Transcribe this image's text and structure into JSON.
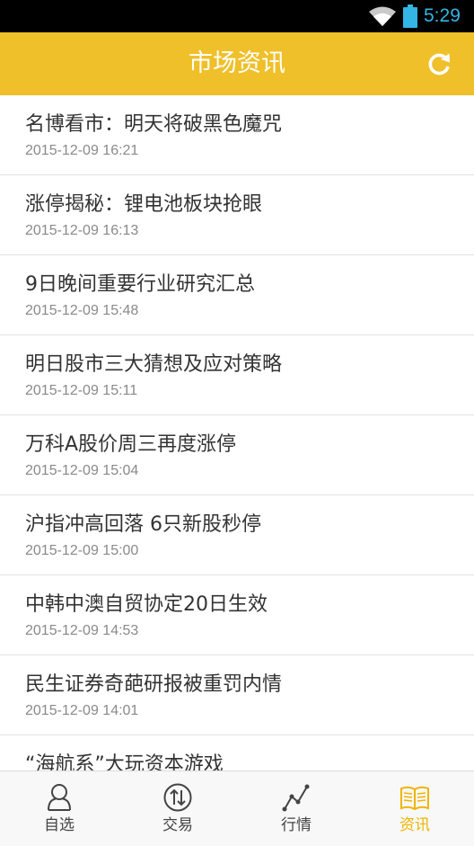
{
  "status_bar": {
    "time": "5:29",
    "icons": [
      "wifi-icon",
      "battery-icon"
    ],
    "color": "#33b5e5"
  },
  "header": {
    "title": "市场资讯",
    "refresh_icon": "refresh-icon",
    "background": "#f0c02a"
  },
  "news": [
    {
      "title": "名博看市：明天将破黑色魔咒",
      "date": "2015-12-09 16:21"
    },
    {
      "title": "涨停揭秘：锂电池板块抢眼",
      "date": "2015-12-09 16:13"
    },
    {
      "title": "9日晚间重要行业研究汇总",
      "date": "2015-12-09 15:48"
    },
    {
      "title": "明日股市三大猜想及应对策略",
      "date": "2015-12-09 15:11"
    },
    {
      "title": "万科A股价周三再度涨停",
      "date": "2015-12-09 15:04"
    },
    {
      "title": "沪指冲高回落 6只新股秒停",
      "date": "2015-12-09 15:00"
    },
    {
      "title": "中韩中澳自贸协定20日生效",
      "date": "2015-12-09 14:53"
    },
    {
      "title": "民生证券奇葩研报被重罚内情",
      "date": "2015-12-09 14:01"
    },
    {
      "title": "“海航系”大玩资本游戏",
      "date": ""
    }
  ],
  "bottom_nav": {
    "items": [
      {
        "label": "自选",
        "icon": "user-icon",
        "active": false
      },
      {
        "label": "交易",
        "icon": "trade-arrows-icon",
        "active": false
      },
      {
        "label": "行情",
        "icon": "line-chart-icon",
        "active": false
      },
      {
        "label": "资讯",
        "icon": "book-icon",
        "active": true
      }
    ],
    "active_color": "#f0b400"
  }
}
